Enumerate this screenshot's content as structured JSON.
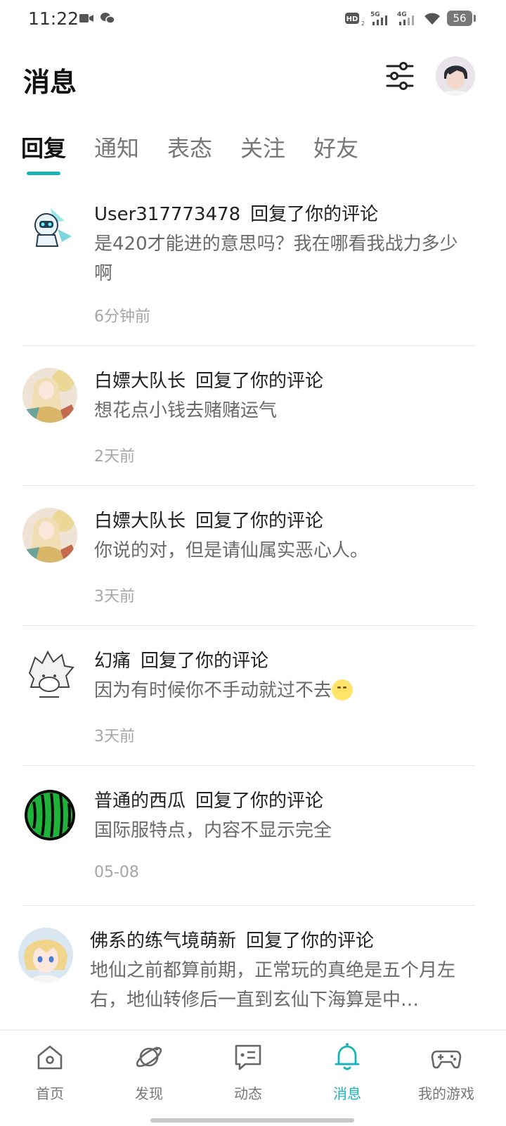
{
  "status_bar": {
    "time": "11:22",
    "network_labels": [
      "HD",
      "5G",
      "4G"
    ],
    "battery": "56"
  },
  "header": {
    "title": "消息",
    "filter_icon": "sliders-icon",
    "avatar_icon": "user-avatar"
  },
  "tabs": [
    {
      "label": "回复",
      "active": true
    },
    {
      "label": "通知",
      "active": false
    },
    {
      "label": "表态",
      "active": false
    },
    {
      "label": "关注",
      "active": false
    },
    {
      "label": "好友",
      "active": false
    }
  ],
  "messages": [
    {
      "user": "User317773478",
      "action": "回复了你的评论",
      "content": "是420才能进的意思吗？我在哪看我战力多少啊",
      "time": "6分钟前",
      "avatar": "robot-avatar"
    },
    {
      "user": "白嫖大队长",
      "action": "回复了你的评论",
      "content": "想花点小钱去赌赌运气",
      "time": "2天前",
      "avatar": "anime-girl-avatar"
    },
    {
      "user": "白嫖大队长",
      "action": "回复了你的评论",
      "content": "你说的对，但是请仙属实恶心人。",
      "time": "3天前",
      "avatar": "anime-girl-avatar"
    },
    {
      "user": "幻痛",
      "action": "回复了你的评论",
      "content": "因为有时候你不手动就过不去",
      "time": "3天前",
      "avatar": "sketch-avatar",
      "emoji": "smirk-emoji"
    },
    {
      "user": "普通的西瓜",
      "action": "回复了你的评论",
      "content": "国际服特点，内容不显示完全",
      "time": "05-08",
      "avatar": "watermelon-avatar"
    },
    {
      "user": "佛系的练气境萌新",
      "action": "回复了你的评论",
      "content": "地仙之前都算前期，正常玩的真绝是五个月左右，地仙转修后一直到玄仙下海算是中…",
      "time": "",
      "avatar": "blonde-anime-avatar"
    }
  ],
  "bottom_nav": [
    {
      "label": "首页",
      "icon": "home-icon",
      "active": false
    },
    {
      "label": "发现",
      "icon": "planet-icon",
      "active": false
    },
    {
      "label": "动态",
      "icon": "chat-icon",
      "active": false
    },
    {
      "label": "消息",
      "icon": "bell-icon",
      "active": true
    },
    {
      "label": "我的游戏",
      "icon": "gamepad-icon",
      "active": false
    }
  ],
  "colors": {
    "accent": "#19b2b8",
    "text_primary": "#222222",
    "text_secondary": "#6a6a6a",
    "text_tertiary": "#a6a6a6"
  }
}
